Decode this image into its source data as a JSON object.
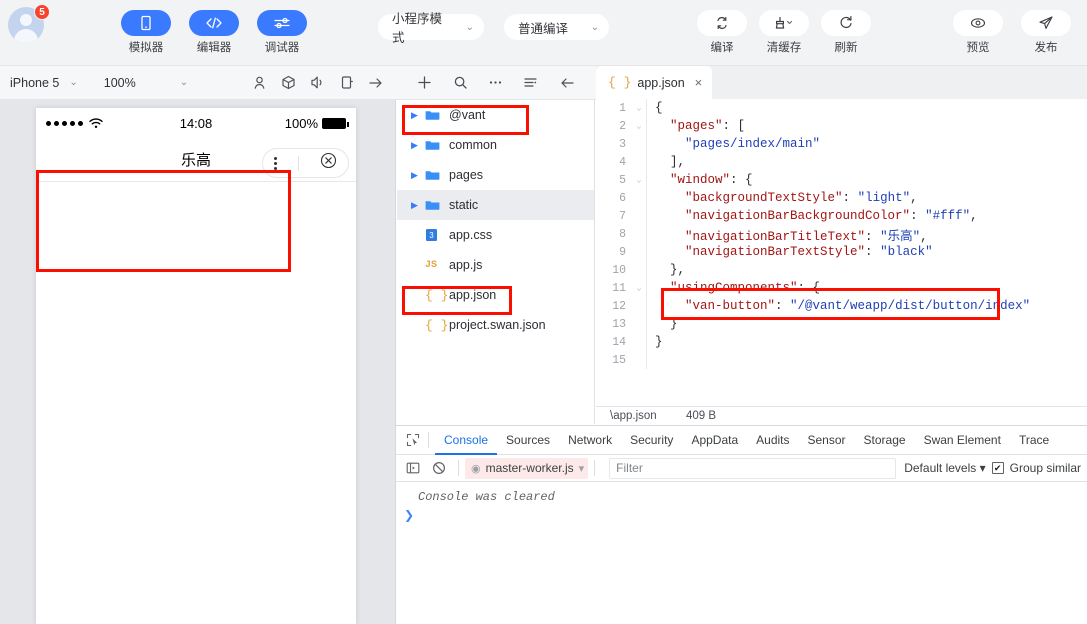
{
  "topbar": {
    "avatar_badge": "5",
    "buttons": [
      {
        "label": "模拟器",
        "icon": "device-icon",
        "style": "primary"
      },
      {
        "label": "编辑器",
        "icon": "code-icon",
        "style": "primary"
      },
      {
        "label": "调试器",
        "icon": "sliders-icon",
        "style": "primary"
      }
    ],
    "mode_select": {
      "value": "小程序模式",
      "chevron": "⌄"
    },
    "compile_select": {
      "value": "普通编译",
      "chevron": "⌄"
    },
    "actions": [
      {
        "label": "编译",
        "icon": "refresh-cycle-icon"
      },
      {
        "label": "清缓存",
        "icon": "broom-icon",
        "has_chevron": true
      },
      {
        "label": "刷新",
        "icon": "reload-icon"
      }
    ],
    "right_actions": [
      {
        "label": "预览",
        "icon": "eye-icon"
      },
      {
        "label": "发布",
        "icon": "send-icon"
      }
    ]
  },
  "simbar": {
    "device": {
      "value": "iPhone 5",
      "chevron": "⌄"
    },
    "zoom": {
      "value": "100%",
      "chevron": "⌄"
    },
    "icons": [
      "person-icon",
      "cube-icon",
      "volume-icon",
      "rotate-device-icon",
      "arrow-right-icon"
    ]
  },
  "explorer_tools": {
    "icons": [
      "add-icon",
      "search-icon",
      "more-icon",
      "collapse-icon",
      "back-icon"
    ]
  },
  "simulator": {
    "status_bar": {
      "time": "14:08",
      "battery_pct": "100%"
    },
    "nav_title": "乐高",
    "capsule": {
      "more": "more-dots-icon",
      "close": "close-circle-icon"
    }
  },
  "explorer": {
    "items": [
      {
        "name": "@vant",
        "type": "folder",
        "expanded": false,
        "selected": false
      },
      {
        "name": "common",
        "type": "folder",
        "expanded": false,
        "selected": false
      },
      {
        "name": "pages",
        "type": "folder",
        "expanded": false,
        "selected": false
      },
      {
        "name": "static",
        "type": "folder",
        "expanded": false,
        "selected": true
      },
      {
        "name": "app.css",
        "type": "css",
        "selected": false
      },
      {
        "name": "app.js",
        "type": "js",
        "selected": false
      },
      {
        "name": "app.json",
        "type": "json",
        "selected": false
      },
      {
        "name": "project.swan.json",
        "type": "json",
        "selected": false
      }
    ]
  },
  "editor": {
    "tab": {
      "label": "app.json",
      "icon": "json-braces-icon",
      "close": "×"
    },
    "status": {
      "path": "\\app.json",
      "size": "409 B"
    },
    "lines": [
      {
        "n": "1",
        "fold": true,
        "segments": [
          {
            "t": "{",
            "c": "p"
          }
        ]
      },
      {
        "n": "2",
        "fold": true,
        "segments": [
          {
            "t": "  ",
            "c": "p"
          },
          {
            "t": "\"pages\"",
            "c": "k"
          },
          {
            "t": ": [",
            "c": "p"
          }
        ]
      },
      {
        "n": "3",
        "fold": false,
        "segments": [
          {
            "t": "    ",
            "c": "p"
          },
          {
            "t": "\"pages/index/main\"",
            "c": "v"
          }
        ]
      },
      {
        "n": "4",
        "fold": false,
        "segments": [
          {
            "t": "  ],",
            "c": "p"
          }
        ]
      },
      {
        "n": "5",
        "fold": true,
        "segments": [
          {
            "t": "  ",
            "c": "p"
          },
          {
            "t": "\"window\"",
            "c": "k"
          },
          {
            "t": ": {",
            "c": "p"
          }
        ]
      },
      {
        "n": "6",
        "fold": false,
        "segments": [
          {
            "t": "    ",
            "c": "p"
          },
          {
            "t": "\"backgroundTextStyle\"",
            "c": "k"
          },
          {
            "t": ": ",
            "c": "p"
          },
          {
            "t": "\"light\"",
            "c": "v"
          },
          {
            "t": ",",
            "c": "p"
          }
        ]
      },
      {
        "n": "7",
        "fold": false,
        "segments": [
          {
            "t": "    ",
            "c": "p"
          },
          {
            "t": "\"navigationBarBackgroundColor\"",
            "c": "k"
          },
          {
            "t": ": ",
            "c": "p"
          },
          {
            "t": "\"#fff\"",
            "c": "v"
          },
          {
            "t": ",",
            "c": "p"
          }
        ]
      },
      {
        "n": "8",
        "fold": false,
        "segments": [
          {
            "t": "    ",
            "c": "p"
          },
          {
            "t": "\"navigationBarTitleText\"",
            "c": "k"
          },
          {
            "t": ": ",
            "c": "p"
          },
          {
            "t": "\"乐高\"",
            "c": "v"
          },
          {
            "t": ",",
            "c": "p"
          }
        ]
      },
      {
        "n": "9",
        "fold": false,
        "segments": [
          {
            "t": "    ",
            "c": "p"
          },
          {
            "t": "\"navigationBarTextStyle\"",
            "c": "k"
          },
          {
            "t": ": ",
            "c": "p"
          },
          {
            "t": "\"black\"",
            "c": "v"
          }
        ]
      },
      {
        "n": "10",
        "fold": false,
        "segments": [
          {
            "t": "  },",
            "c": "p"
          }
        ]
      },
      {
        "n": "11",
        "fold": true,
        "segments": [
          {
            "t": "  ",
            "c": "p"
          },
          {
            "t": "\"usingComponents\"",
            "c": "k"
          },
          {
            "t": ": {",
            "c": "p"
          }
        ]
      },
      {
        "n": "12",
        "fold": false,
        "segments": [
          {
            "t": "    ",
            "c": "p"
          },
          {
            "t": "\"van-button\"",
            "c": "k"
          },
          {
            "t": ": ",
            "c": "p"
          },
          {
            "t": "\"/@vant/weapp/dist/button/index\"",
            "c": "v"
          }
        ]
      },
      {
        "n": "13",
        "fold": false,
        "segments": [
          {
            "t": "  }",
            "c": "p"
          }
        ]
      },
      {
        "n": "14",
        "fold": false,
        "segments": [
          {
            "t": "}",
            "c": "p"
          }
        ]
      },
      {
        "n": "15",
        "fold": false,
        "segments": [
          {
            "t": "",
            "c": "p"
          }
        ]
      }
    ]
  },
  "devtools": {
    "tabs": [
      {
        "label": "Console",
        "active": true
      },
      {
        "label": "Sources",
        "active": false
      },
      {
        "label": "Network",
        "active": false
      },
      {
        "label": "Security",
        "active": false
      },
      {
        "label": "AppData",
        "active": false
      },
      {
        "label": "Audits",
        "active": false
      },
      {
        "label": "Sensor",
        "active": false
      },
      {
        "label": "Storage",
        "active": false
      },
      {
        "label": "Swan Element",
        "active": false
      },
      {
        "label": "Trace",
        "active": false
      }
    ],
    "toolbar": {
      "context": "master-worker.js",
      "context_chevron": "▾",
      "filter_placeholder": "Filter",
      "levels": "Default levels",
      "levels_chevron": "▾",
      "group_similar": "Group similar",
      "group_checked": "✔"
    },
    "console_message": "Console was cleared",
    "prompt": "❯"
  },
  "colors": {
    "accent": "#3a7afe",
    "annotation": "#fa0f00",
    "devtools_accent": "#1a73e8",
    "badge": "#f5452c"
  }
}
